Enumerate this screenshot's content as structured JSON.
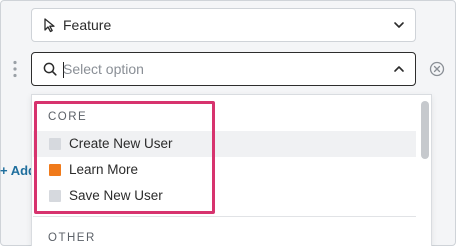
{
  "feature_select": {
    "value": "Feature"
  },
  "search_select": {
    "placeholder": "Select option"
  },
  "add_link": {
    "label": "+ Add"
  },
  "dropdown": {
    "groups": [
      {
        "label": "CORE",
        "options": [
          {
            "label": "Create New User",
            "color": "#d6d9de"
          },
          {
            "label": "Learn More",
            "color": "#f07a1a"
          },
          {
            "label": "Save New User",
            "color": "#d6d9de"
          }
        ]
      },
      {
        "label": "OTHER"
      }
    ]
  },
  "colors": {
    "annotation": "#d7336e",
    "link": "#1f6f9e"
  }
}
